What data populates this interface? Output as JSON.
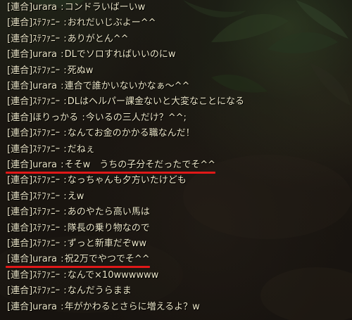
{
  "chat_log": {
    "separator": ":",
    "lines": [
      {
        "channel": "[連合]",
        "speaker": "urara",
        "message": "コンドラいばーいw"
      },
      {
        "channel": "[連合]",
        "speaker": "ｽﾃﾌｧﾆｰ",
        "message": "おれだいじぶよー^^"
      },
      {
        "channel": "[連合]",
        "speaker": "ｽﾃﾌｧﾆｰ",
        "message": "ありがとん^^"
      },
      {
        "channel": "[連合]",
        "speaker": "urara",
        "message": "DLでソロすればいいのにw"
      },
      {
        "channel": "[連合]",
        "speaker": "ｽﾃﾌｧﾆｰ",
        "message": "死ぬw"
      },
      {
        "channel": "[連合]",
        "speaker": "urara",
        "message": "連合で誰かいないかなぁ～^^"
      },
      {
        "channel": "[連合]",
        "speaker": "ｽﾃﾌｧﾆｰ",
        "message": "DLはヘルパー課金ないと大変なことになる"
      },
      {
        "channel": "[連合]",
        "speaker": "ほりっかる",
        "message": "今いるの三人だけ？^^;"
      },
      {
        "channel": "[連合]",
        "speaker": "ｽﾃﾌｧﾆｰ",
        "message": "なんてお金のかかる職なんだ！"
      },
      {
        "channel": "[連合]",
        "speaker": "ｽﾃﾌｧﾆｰ",
        "message": "だねぇ"
      },
      {
        "channel": "[連合]",
        "speaker": "urara",
        "message": "そそw　うちの子分そだったでそ^^"
      },
      {
        "channel": "[連合]",
        "speaker": "ｽﾃﾌｧﾆｰ",
        "message": "なっちゃんも夕方いたけども"
      },
      {
        "channel": "[連合]",
        "speaker": "ｽﾃﾌｧﾆｰ",
        "message": "えw"
      },
      {
        "channel": "[連合]",
        "speaker": "ｽﾃﾌｧﾆｰ",
        "message": "あのやたら高い馬は"
      },
      {
        "channel": "[連合]",
        "speaker": "ｽﾃﾌｧﾆｰ",
        "message": "隊長の乗り物なので"
      },
      {
        "channel": "[連合]",
        "speaker": "ｽﾃﾌｧﾆｰ",
        "message": "ずっと新車だぞww"
      },
      {
        "channel": "[連合]",
        "speaker": "urara",
        "message": "祝2万でやつでそ^^"
      },
      {
        "channel": "[連合]",
        "speaker": "ｽﾃﾌｧﾆｰ",
        "message": "なんで×10wwwwww"
      },
      {
        "channel": "[連合]",
        "speaker": "ｽﾃﾌｧﾆｰ",
        "message": "なんだうらまま"
      },
      {
        "channel": "[連合]",
        "speaker": "urara",
        "message": "年がかわるとさらに増えるよ？w"
      }
    ],
    "highlighted_lines": [
      10,
      16
    ],
    "highlight_color": "#e01818",
    "text_color": "#ece6c8"
  }
}
